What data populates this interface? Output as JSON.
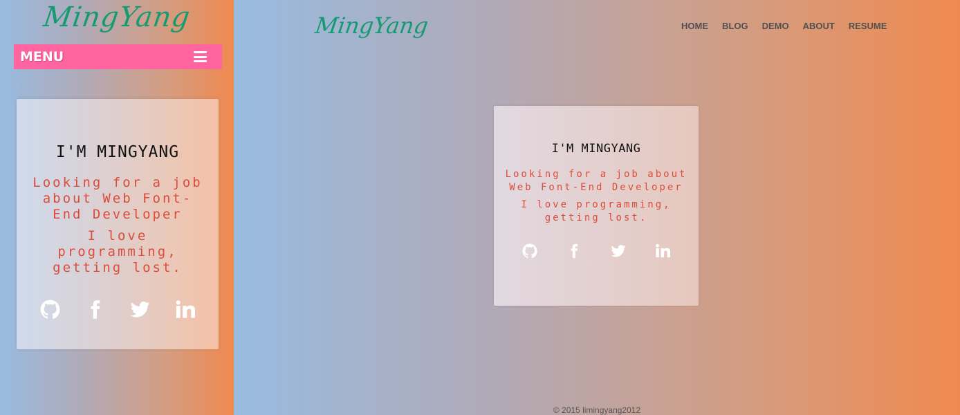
{
  "brand": {
    "logo_text": "MingYang",
    "logo_color": "#169a72"
  },
  "nav": {
    "items": [
      {
        "label": "HOME"
      },
      {
        "label": "BLOG"
      },
      {
        "label": "DEMO"
      },
      {
        "label": "ABOUT"
      },
      {
        "label": "RESUME"
      }
    ]
  },
  "mobile": {
    "menu_label": "MENU",
    "menu_color": "#ff64a1"
  },
  "card": {
    "title": "I'M MINGYANG",
    "subtitle": "Looking for a job about Web Font-End Developer",
    "tagline": "I love programming, getting lost.",
    "accent_color": "#dc4c3a",
    "socials": [
      {
        "icon": "github-icon"
      },
      {
        "icon": "facebook-icon"
      },
      {
        "icon": "twitter-icon"
      },
      {
        "icon": "linkedin-icon"
      }
    ]
  },
  "footer": {
    "text": "© 2015  limingyang2012"
  },
  "colors": {
    "gradient_start": "#98bbe0",
    "gradient_end": "#f0894f"
  }
}
